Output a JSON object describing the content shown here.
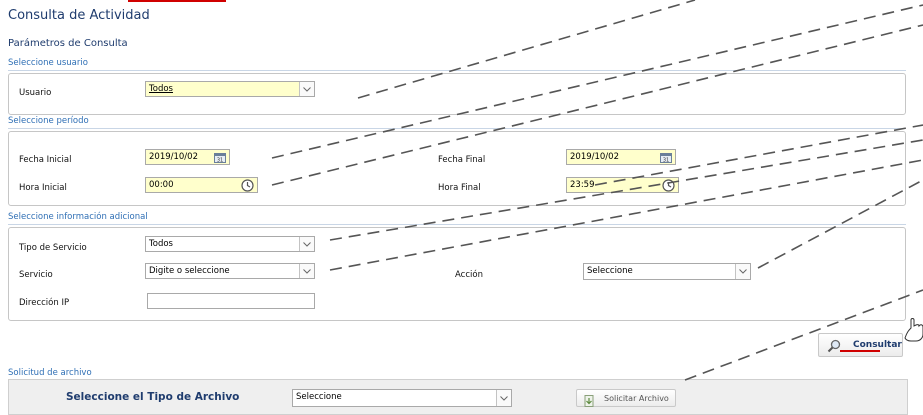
{
  "page": {
    "title": "Consulta de Actividad",
    "subtitle": "Parámetros de Consulta"
  },
  "colors": {
    "accent_blue": "#2f6fb5",
    "title_blue": "#1f3c6e",
    "highlight_yellow": "#ffffcc",
    "annotation_red": "#d00000"
  },
  "user_section": {
    "label": "Seleccione usuario",
    "user_label": "Usuario",
    "user_value": "Todos"
  },
  "period_section": {
    "label": "Seleccione período",
    "start_date_label": "Fecha Inicial",
    "start_date_value": "2019/10/02",
    "end_date_label": "Fecha Final",
    "end_date_value": "2019/10/02",
    "start_time_label": "Hora Inicial",
    "start_time_value": "00:00",
    "end_time_label": "Hora Final",
    "end_time_value": "23:59",
    "date_icon": "calendar-icon",
    "time_icon": "clock-icon"
  },
  "additional_section": {
    "label": "Seleccione información adicional",
    "service_type_label": "Tipo de Servicio",
    "service_type_value": "Todos",
    "service_label": "Servicio",
    "service_placeholder": "Digite o seleccione",
    "action_label": "Acción",
    "action_value": "Seleccione",
    "ip_label": "Dirección IP",
    "ip_value": ""
  },
  "consult_button": {
    "label": "Consultar",
    "icon": "magnifier-icon"
  },
  "file_section": {
    "label": "Solicitud de archivo",
    "file_type_label": "Seleccione el Tipo de Archivo",
    "file_type_value": "Seleccione",
    "request_button_label": "Solicitar Archivo",
    "request_icon": "file-request-icon"
  },
  "annotation": {
    "pointer_icon": "hand-pointer-icon"
  }
}
